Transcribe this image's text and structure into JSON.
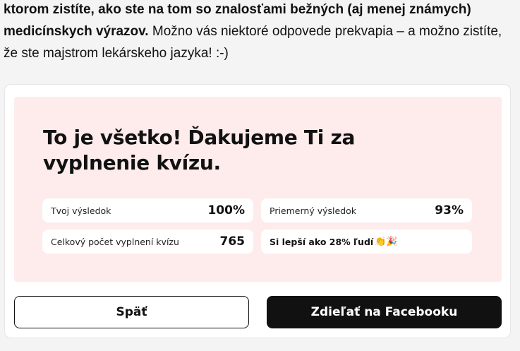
{
  "intro": {
    "bold_part": "ktorom zistíte, ako ste na tom so znalosťami bežných (aj menej známych) medicínskych výrazov.",
    "regular_part": " Možno vás niektoré odpovede prekvapia – a možno zistíte, že ste majstrom lekárskeho jazyka! :-)"
  },
  "result": {
    "title": "To je všetko! Ďakujeme Ti za vyplnenie kvízu.",
    "your_score_label": "Tvoj výsledok",
    "your_score_value": "100%",
    "average_label": "Priemerný výsledok",
    "average_value": "93%",
    "total_label": "Celkový počet vyplnení kvízu",
    "total_value": "765",
    "better_than": "Si lepší ako 28% ľudí",
    "better_than_emoji": "👏🎉"
  },
  "actions": {
    "back_label": "Späť",
    "share_label": "Zdieľať na Facebooku"
  },
  "colors": {
    "panel_bg": "#fdeceb",
    "primary_button": "#111111"
  }
}
